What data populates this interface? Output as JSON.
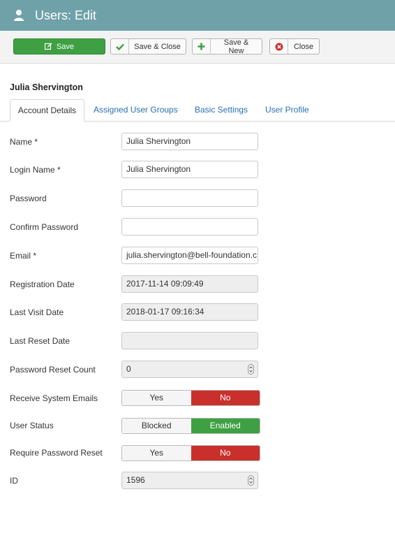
{
  "header": {
    "title": "Users: Edit",
    "icon": "user-icon"
  },
  "toolbar": {
    "save": "Save",
    "save_close": "Save & Close",
    "save_new": "Save & New",
    "close": "Close"
  },
  "user": {
    "name": "Julia Shervington"
  },
  "tabs": [
    {
      "label": "Account Details",
      "active": true
    },
    {
      "label": "Assigned User Groups"
    },
    {
      "label": "Basic Settings"
    },
    {
      "label": "User Profile"
    }
  ],
  "form": {
    "name": {
      "label": "Name *",
      "value": "Julia Shervington"
    },
    "login": {
      "label": "Login Name *",
      "value": "Julia Shervington"
    },
    "password": {
      "label": "Password",
      "value": ""
    },
    "confirm": {
      "label": "Confirm Password",
      "value": ""
    },
    "email": {
      "label": "Email *",
      "value": "julia.shervington@bell-foundation.c"
    },
    "regdate": {
      "label": "Registration Date",
      "value": "2017-11-14 09:09:49"
    },
    "lastvisit": {
      "label": "Last Visit Date",
      "value": "2018-01-17 09:16:34"
    },
    "lastreset": {
      "label": "Last Reset Date",
      "value": ""
    },
    "resetcount": {
      "label": "Password Reset Count",
      "value": "0"
    },
    "sysemails": {
      "label": "Receive System Emails",
      "yes": "Yes",
      "no": "No",
      "selected": "No"
    },
    "status": {
      "label": "User Status",
      "blocked": "Blocked",
      "enabled": "Enabled",
      "selected": "Enabled"
    },
    "requirereset": {
      "label": "Require Password Reset",
      "yes": "Yes",
      "no": "No",
      "selected": "No"
    },
    "id": {
      "label": "ID",
      "value": "1596"
    }
  },
  "colors": {
    "header": "#6ea2a8",
    "save": "#3ea043",
    "danger": "#c9302c",
    "link": "#2a6fb0"
  }
}
